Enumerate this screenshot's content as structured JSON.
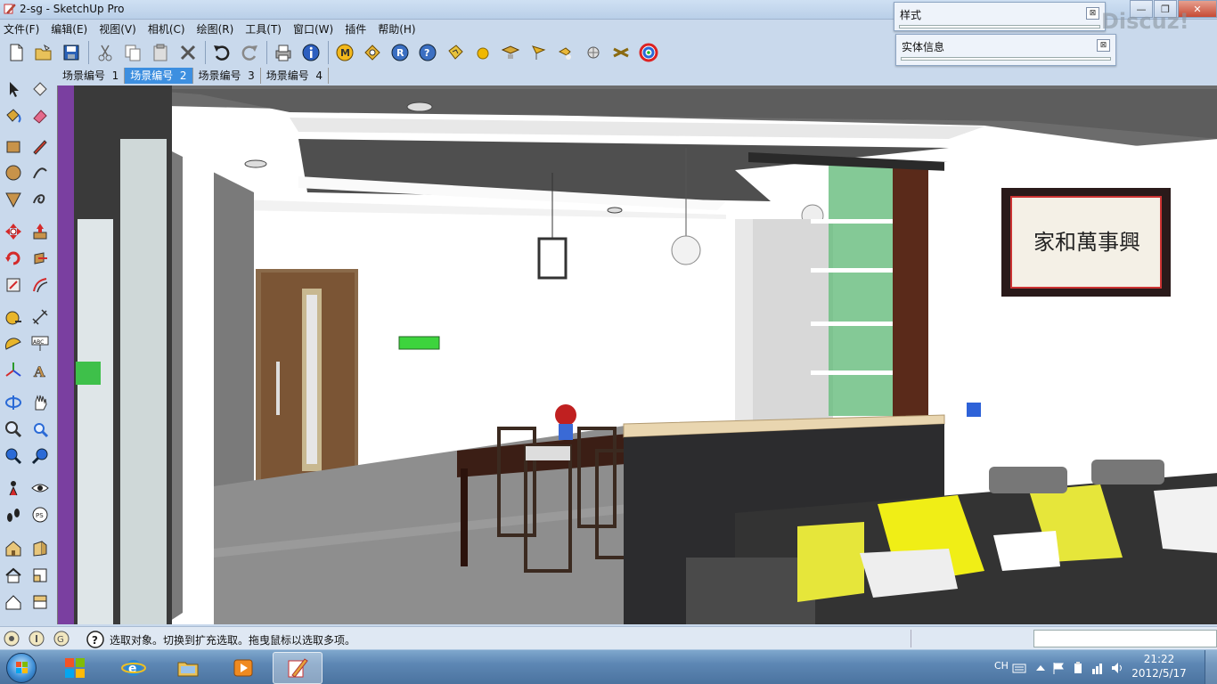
{
  "window": {
    "title": "2-sg - SketchUp Pro",
    "app_icon": "sketchup-pencil-icon"
  },
  "menu": {
    "items": [
      "文件(F)",
      "编辑(E)",
      "视图(V)",
      "相机(C)",
      "绘图(R)",
      "工具(T)",
      "窗口(W)",
      "插件",
      "帮助(H)"
    ]
  },
  "panels": {
    "style": {
      "title": "样式"
    },
    "entity_info": {
      "title": "实体信息"
    }
  },
  "watermark": "Discuz!",
  "toolbar": {
    "icons": [
      "new-file-icon",
      "open-folder-icon",
      "save-icon",
      "cut-icon",
      "copy-icon",
      "paste-icon",
      "delete-icon",
      "undo-icon",
      "redo-icon",
      "print-icon",
      "model-info-icon",
      "plugin-m-icon",
      "plugin-tag-icon",
      "plugin-r-icon",
      "help-icon",
      "plugin-tag2-icon",
      "sphere-icon",
      "plugin-hat-icon",
      "plugin-flag-icon",
      "plugin-hand-icon",
      "plugin-ball-icon",
      "plugin-cross-icon",
      "plugin-swirl-icon"
    ]
  },
  "scenes": {
    "tabs": [
      {
        "label": "场景编号  1",
        "active": false
      },
      {
        "label": "场景编号  2",
        "active": true
      },
      {
        "label": "场景编号  3",
        "active": false
      },
      {
        "label": "场景编号  4",
        "active": false
      }
    ]
  },
  "left_tools": [
    "select-icon",
    "make-component-icon",
    "paint-bucket-icon",
    "eraser-icon",
    "rectangle-icon",
    "pencil-icon",
    "circle-icon",
    "arc-icon",
    "polygon-icon",
    "freehand-icon",
    "move-icon",
    "push-pull-icon",
    "rotate-icon",
    "follow-me-icon",
    "scale-icon",
    "offset-icon",
    "tape-measure-icon",
    "dimension-icon",
    "protractor-icon",
    "text-icon",
    "axes-icon",
    "3d-text-icon",
    "orbit-icon",
    "pan-icon",
    "zoom-icon",
    "zoom-window-icon",
    "previous-view-icon",
    "next-view-icon",
    "position-camera-icon",
    "look-around-icon",
    "walk-icon",
    "section-plane-icon",
    "warehouse-icon",
    "share-model-icon",
    "house-icon",
    "front-view-icon",
    "roof-icon",
    "side-view-icon"
  ],
  "scene3d": {
    "painting_text": "家和萬事興"
  },
  "status": {
    "text": "选取对象。切换到扩充选取。拖曳鼠标以选取多项。"
  },
  "taskbar": {
    "language": "CH",
    "time": "21:22",
    "date": "2012/5/17"
  }
}
